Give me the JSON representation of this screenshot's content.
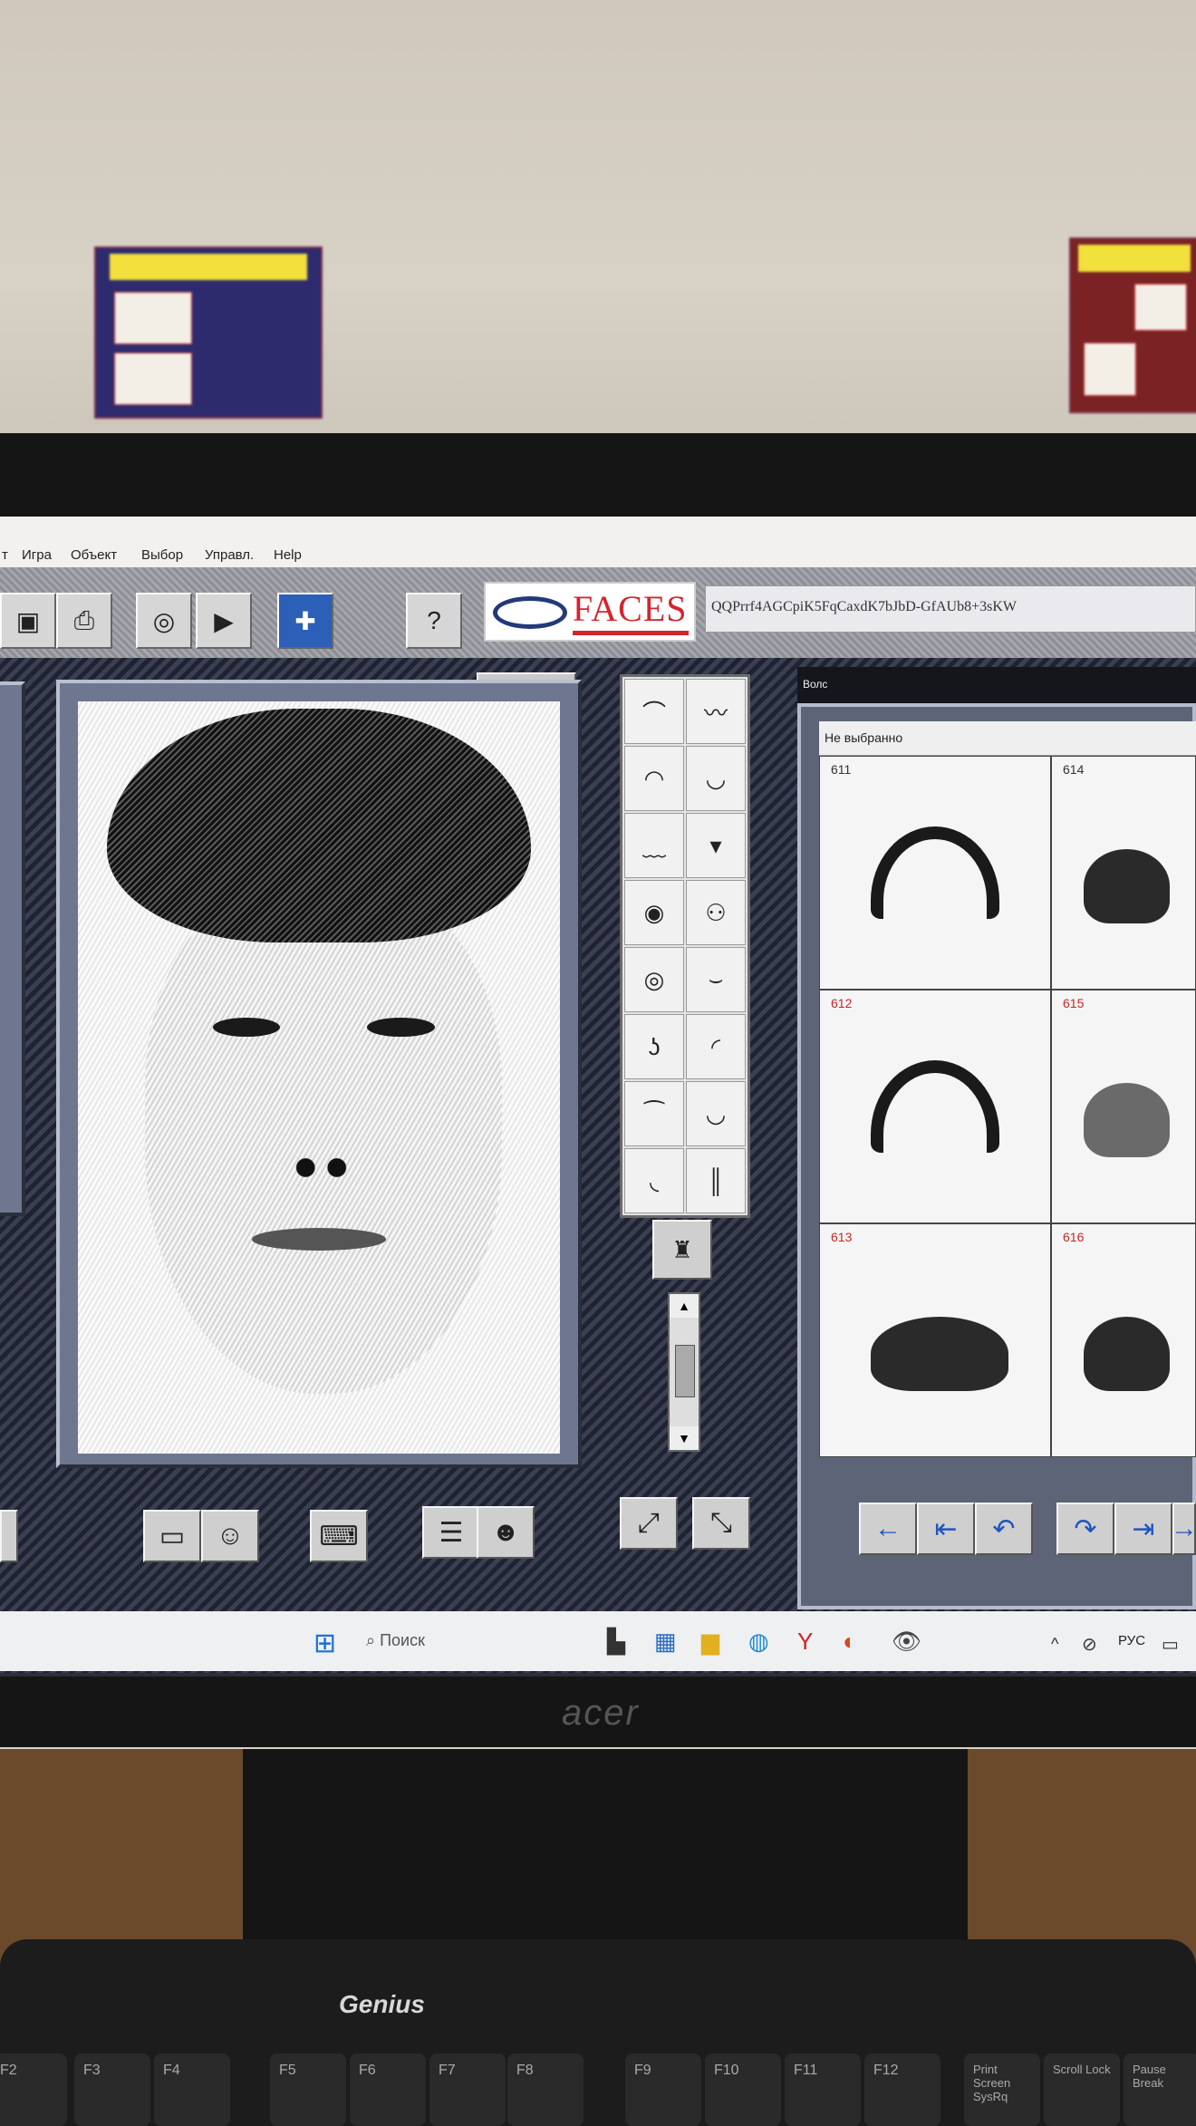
{
  "window": {
    "menu": [
      "т",
      "Игра",
      "Объект",
      "Выбор",
      "Управл.",
      "Help"
    ],
    "toolbar_icons": [
      "save-icon",
      "print-icon",
      "spiral-icon",
      "play-icon",
      "puzzle-icon",
      "help-icon"
    ],
    "logo": {
      "text": "FACES"
    },
    "code": "QQPrrf4AGCpiK5FqCaxdK7bJbD-GfAUb8+3sKW"
  },
  "parts_panel": {
    "icons": [
      "hair-icon",
      "mustache-icon",
      "forehead-icon",
      "beard-icon",
      "brows-icon",
      "goatee-icon",
      "eyes-icon",
      "glasses-icon",
      "eye-closeup-icon",
      "lip-icon",
      "nose-icon",
      "cheeks-icon",
      "mouth-icon",
      "smile-icon",
      "chin-icon",
      "neck-icon"
    ]
  },
  "selection": {
    "title": "Волс",
    "status": "Не выбранно",
    "items": [
      {
        "num": "611",
        "kind": "hair",
        "highlight": false
      },
      {
        "num": "614",
        "kind": "cap",
        "highlight": false
      },
      {
        "num": "612",
        "kind": "hair",
        "highlight": true
      },
      {
        "num": "615",
        "kind": "cap",
        "highlight": true
      },
      {
        "num": "613",
        "kind": "cap",
        "highlight": true
      },
      {
        "num": "616",
        "kind": "cap",
        "highlight": true
      }
    ]
  },
  "taskbar": {
    "search": "Поиск",
    "lang": "РУС"
  },
  "monitor": {
    "brand": "acer"
  },
  "keyboard": {
    "brand": "Genius",
    "keys": [
      "F2",
      "F3",
      "F4",
      "F5",
      "F6",
      "F7",
      "F8",
      "F9",
      "F10",
      "F11",
      "F12",
      "Print Screen SysRq",
      "Scroll Lock",
      "Pause Break"
    ]
  }
}
